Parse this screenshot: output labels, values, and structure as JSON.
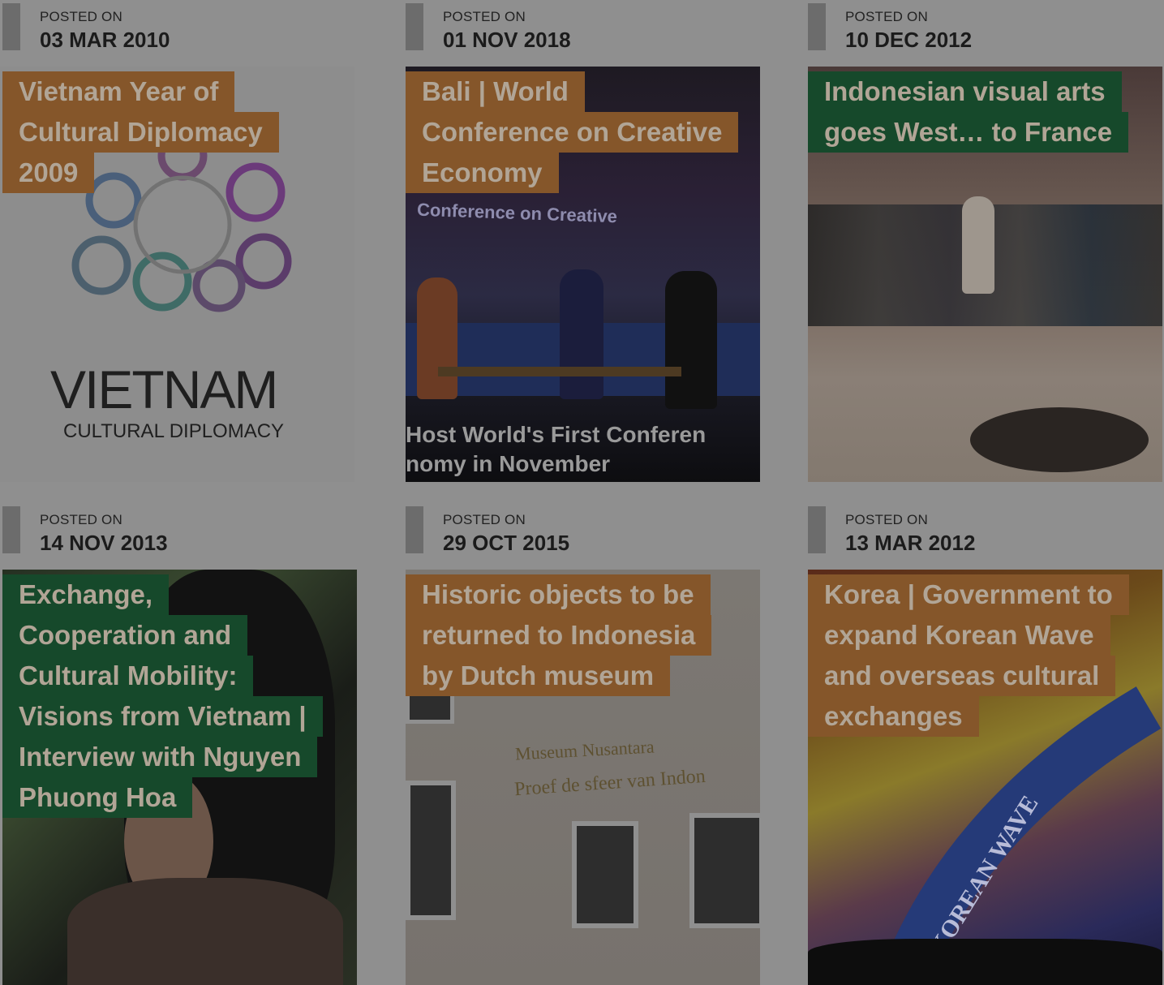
{
  "posted_label": "POSTED ON",
  "posts": [
    {
      "date": "03 MAR 2010",
      "title_lines": [
        "Vietnam Year of",
        "Cultural Diplomacy",
        "2009"
      ],
      "title_color": "#85562a",
      "logo_text": "VIETNAM",
      "logo_sub": "CULTURAL DIPLOMACY"
    },
    {
      "date": "01 NOV 2018",
      "title_lines": [
        "Bali | World",
        "Conference on Creative",
        "Economy"
      ],
      "title_color": "#85562a",
      "banner_text": "Conference on Creative",
      "caption_line1": "Host World's First Conferen",
      "caption_line2": "nomy in November"
    },
    {
      "date": "10 DEC 2012",
      "title_lines": [
        "Indonesian visual arts",
        "goes West… to France"
      ],
      "title_color": "#16492b"
    },
    {
      "date": "14 NOV 2013",
      "title_lines": [
        "Exchange,",
        "Cooperation and",
        "Cultural Mobility:",
        "Visions from Vietnam |",
        "Interview with Nguyen",
        "Phuong Hoa"
      ],
      "title_color": "#16492b"
    },
    {
      "date": "29 OCT 2015",
      "title_lines": [
        "Historic objects to be",
        "returned to Indonesia",
        "by Dutch museum"
      ],
      "title_color": "#85562a",
      "sign_line1": "Museum Nusantara",
      "sign_line2": "Proef de sfeer van Indon"
    },
    {
      "date": "13 MAR 2012",
      "title_lines": [
        "Korea | Government to",
        "expand Korean Wave",
        "and overseas cultural",
        "exchanges"
      ],
      "title_color": "#85562a",
      "wave_text": "KOREAN WAVE"
    }
  ]
}
